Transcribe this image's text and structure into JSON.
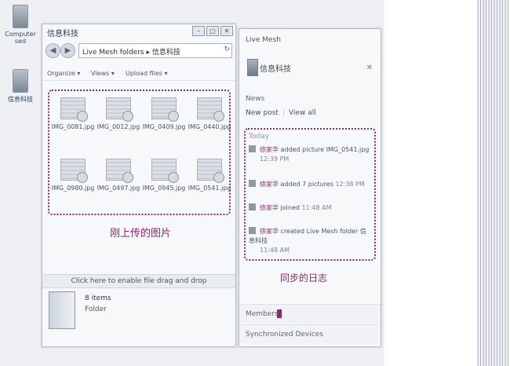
{
  "desktop": {
    "icons": [
      {
        "label": "Computer\nsed"
      },
      {
        "label": "信息科技"
      }
    ]
  },
  "explorer": {
    "title": "信息科技",
    "address": "Live Mesh folders ▸ 信息科技",
    "toolbar": {
      "organize": "Organize ▾",
      "views": "Views ▾",
      "upload": "Upload files ▾"
    },
    "files": [
      {
        "name": "IMG_0081.jpg"
      },
      {
        "name": "IMG_0012.jpg"
      },
      {
        "name": "IMG_0409.jpg"
      },
      {
        "name": "IMG_0440.jpg"
      },
      {
        "name": "IMG_0980.jpg"
      },
      {
        "name": "IMG_0497.jpg"
      },
      {
        "name": "IMG_0945.jpg"
      },
      {
        "name": "IMG_0541.jpg"
      }
    ],
    "uploaded_note": "刚上传的图片",
    "drag_text": "Click here to enable file drag and drop",
    "details": {
      "count": "8 items",
      "kind": "Folder"
    }
  },
  "mesh": {
    "app_title": "Live Mesh",
    "folder": "信息科技",
    "news": "News",
    "new_post": "New post",
    "view_all": "View all",
    "today": "Today",
    "entries": [
      {
        "user": "徐家华",
        "action": "added picture IMG_0541.jpg",
        "time": "12:39 PM"
      },
      {
        "user": "徐家华",
        "action": "added 7 pictures",
        "time": "12:38 PM"
      },
      {
        "user": "徐家华",
        "action": "joined",
        "time": "11:48 AM"
      },
      {
        "user": "徐家华",
        "action": "created Live Mesh folder 信息科技",
        "time": "11:48 AM"
      }
    ],
    "sync_note": "同步的日志",
    "members": "Members",
    "devices": "Synchronized Devices"
  }
}
